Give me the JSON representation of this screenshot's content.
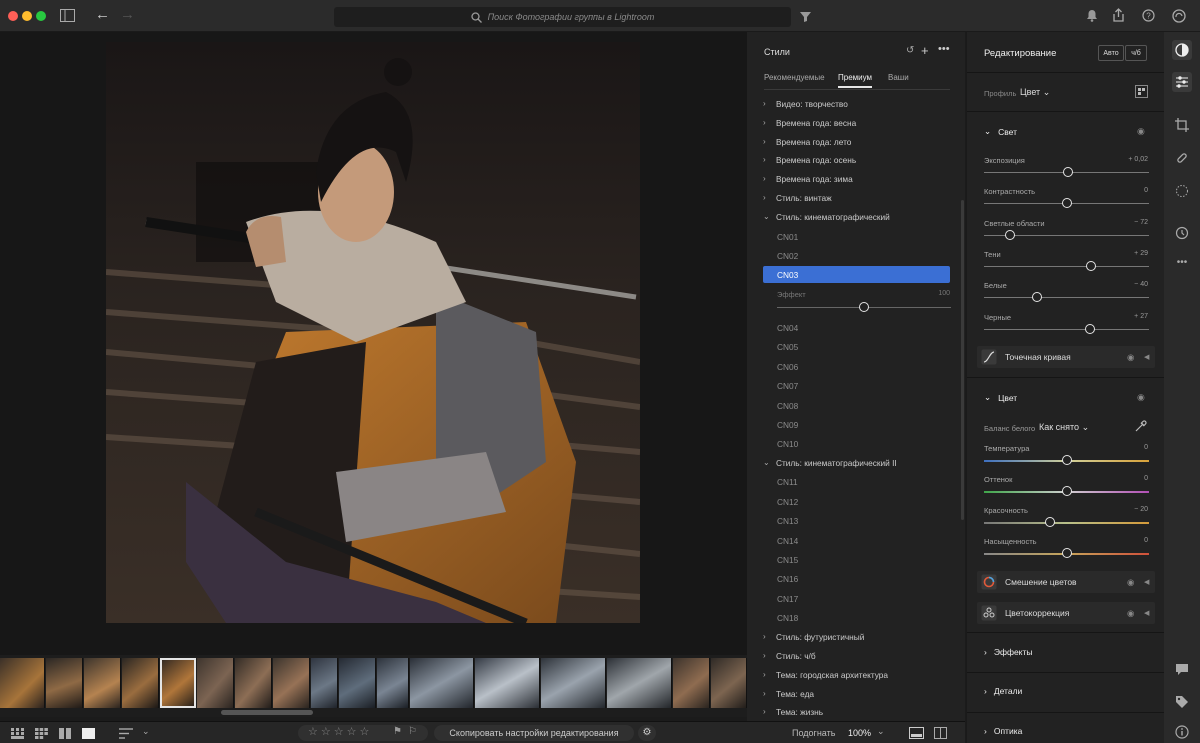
{
  "topbar": {
    "search_placeholder": "Поиск Фотографии группы в Lightroom",
    "traffic_colors": [
      "#fe5f57",
      "#febc2e",
      "#28c840"
    ]
  },
  "styles_panel": {
    "title": "Стили",
    "tabs": [
      "Рекомендуемые",
      "Премиум",
      "Ваши"
    ],
    "active_tab": "Премиум",
    "groups_top": [
      "Видео: творчество",
      "Времена года: весна",
      "Времена года: лето",
      "Времена года: осень",
      "Времена года: зима",
      "Стиль: винтаж",
      "Стиль: кинематографический"
    ],
    "cinematic_items_a": [
      "CN01",
      "CN02",
      "CN03"
    ],
    "selected_item": "CN03",
    "effect_label": "Эффект",
    "effect_value": "100",
    "cinematic_items_b": [
      "CN04",
      "CN05",
      "CN06",
      "CN07",
      "CN08",
      "CN09",
      "CN10"
    ],
    "group_cin2": "Стиль: кинематографический II",
    "cinematic2_items": [
      "CN11",
      "CN12",
      "CN13",
      "CN14",
      "CN15",
      "CN16",
      "CN17",
      "CN18"
    ],
    "groups_bottom": [
      "Стиль: футуристичный",
      "Стиль: ч/б",
      "Тема: городская архитектура",
      "Тема: еда",
      "Тема: жизнь"
    ]
  },
  "edit_panel": {
    "title": "Редактирование",
    "auto_button": "Авто",
    "bw_button": "ч/б",
    "profile_label": "Профиль",
    "profile_value": "Цвет",
    "light_section": "Свет",
    "light_sliders": [
      {
        "label": "Экспозиция",
        "value": "+ 0,02",
        "pos": 0.51
      },
      {
        "label": "Контрастность",
        "value": "0",
        "pos": 0.5
      },
      {
        "label": "Светлые области",
        "value": "− 72",
        "pos": 0.16
      },
      {
        "label": "Тени",
        "value": "+ 29",
        "pos": 0.65
      },
      {
        "label": "Белые",
        "value": "− 40",
        "pos": 0.32
      },
      {
        "label": "Черные",
        "value": "+ 27",
        "pos": 0.64
      }
    ],
    "point_curve": "Точечная кривая",
    "color_section": "Цвет",
    "wb_label": "Баланс белого",
    "wb_value": "Как снято",
    "color_sliders": [
      {
        "label": "Температура",
        "value": "0",
        "pos": 0.5
      },
      {
        "label": "Оттенок",
        "value": "0",
        "pos": 0.5
      },
      {
        "label": "Красочность",
        "value": "− 20",
        "pos": 0.4
      },
      {
        "label": "Насыщенность",
        "value": "0",
        "pos": 0.5
      }
    ],
    "color_mix": "Смешение цветов",
    "color_grading": "Цветокоррекция",
    "effects": "Эффекты",
    "details": "Детали",
    "optics": "Оптика"
  },
  "bottombar": {
    "copy_settings": "Скопировать настройки редактирования",
    "zoom_label": "Подогнать",
    "zoom_value": "100%",
    "rating_stars": 5
  }
}
